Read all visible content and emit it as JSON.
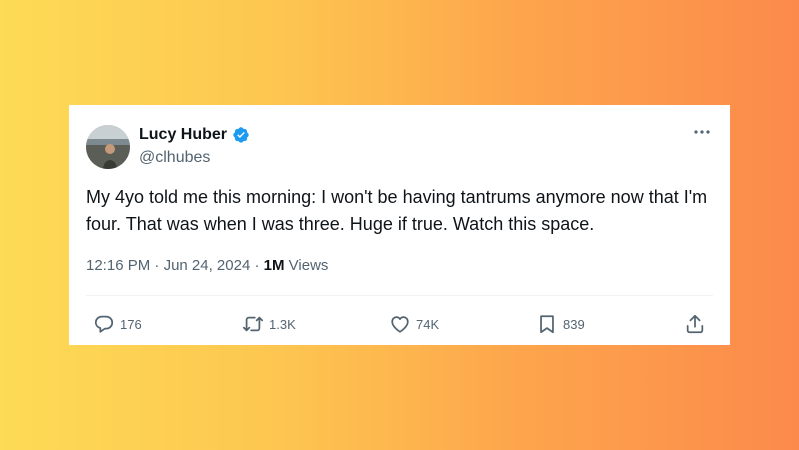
{
  "tweet": {
    "author_name": "Lucy Huber",
    "author_handle": "@clhubes",
    "text": "My 4yo told me this morning: I won't be having tantrums anymore now that I'm four. That was when I was three. Huge if true. Watch this space.",
    "time": "12:16 PM",
    "separator": "·",
    "date": "Jun 24, 2024",
    "views_count": "1M",
    "views_label": "Views",
    "verified": true
  },
  "actions": {
    "replies": "176",
    "retweets": "1.3K",
    "likes": "74K",
    "bookmarks": "839"
  },
  "icons": {
    "verified": "verified-badge-icon",
    "more": "more-options-icon",
    "reply": "reply-icon",
    "retweet": "retweet-icon",
    "like": "heart-icon",
    "bookmark": "bookmark-icon",
    "share": "share-icon"
  },
  "colors": {
    "verified_blue": "#1d9bf0",
    "text_primary": "#0f1419",
    "text_secondary": "#536471"
  }
}
